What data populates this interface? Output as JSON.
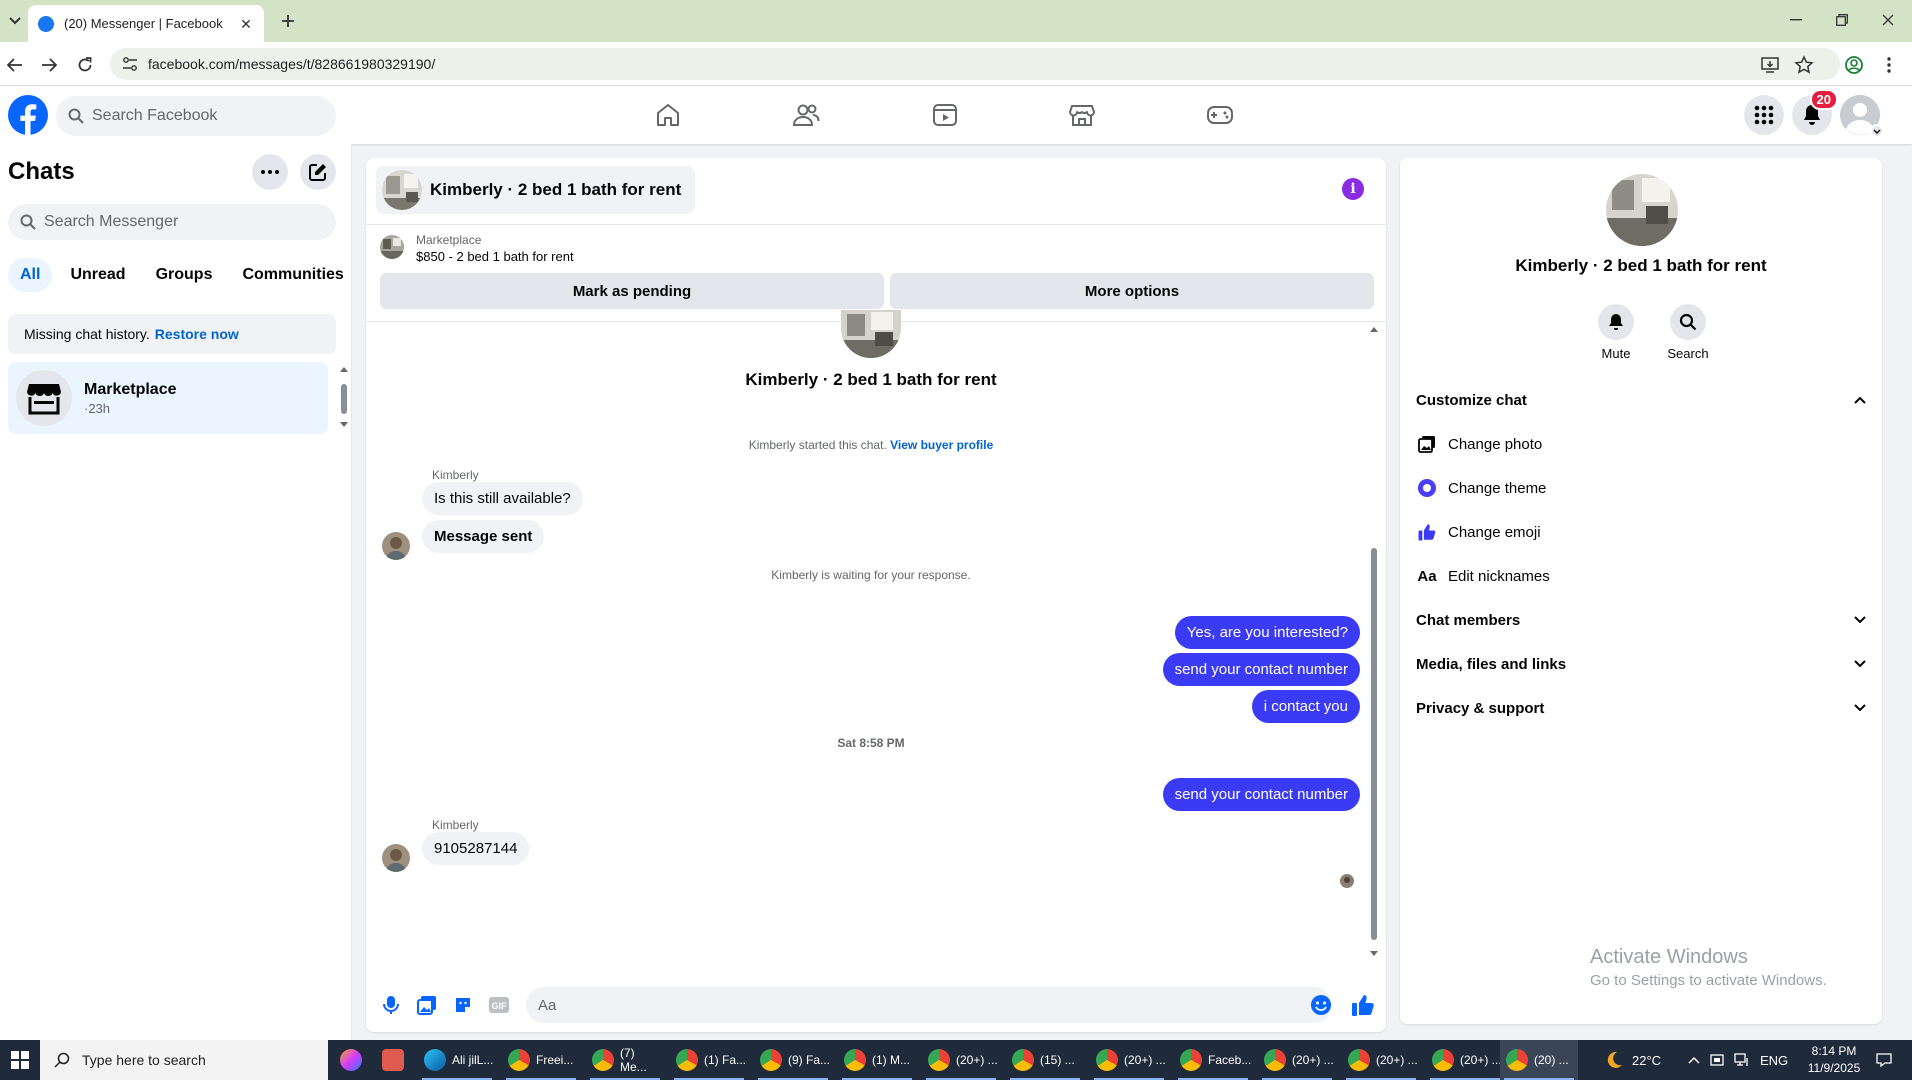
{
  "browser": {
    "tab_title": "(20) Messenger | Facebook",
    "url": "facebook.com/messages/t/828661980329190/"
  },
  "fb_header": {
    "search_placeholder": "Search Facebook",
    "notification_count": "20"
  },
  "sidebar": {
    "title": "Chats",
    "search_placeholder": "Search Messenger",
    "filters": [
      "All",
      "Unread",
      "Groups",
      "Communities"
    ],
    "history_notice": "Missing chat history.",
    "history_link": "Restore now",
    "chat_item": {
      "name": "Marketplace",
      "time": "·23h"
    }
  },
  "conversation": {
    "header_title": "Kimberly · 2 bed 1 bath for rent",
    "marketplace_label": "Marketplace",
    "listing": "$850 - 2 bed 1 bath for rent",
    "mark_pending": "Mark as pending",
    "more_options": "More options",
    "chat_title": "Kimberly · 2 bed 1 bath for rent",
    "started_text": "Kimberly started this chat.",
    "view_profile": "View buyer profile",
    "sender_name_1": "Kimberly",
    "msg_in_1": "Is this still available?",
    "msg_in_2": "Message sent",
    "waiting_text": "Kimberly is waiting for your response.",
    "msg_out_1": "Yes, are you interested?",
    "msg_out_2": "send your contact number",
    "msg_out_3": "i contact you",
    "timestamp": "Sat 8:58 PM",
    "msg_out_4": "send your contact number",
    "sender_name_2": "Kimberly",
    "msg_in_3": "9105287144",
    "composer_placeholder": "Aa"
  },
  "info_panel": {
    "name": "Kimberly · 2 bed 1 bath for rent",
    "mute_label": "Mute",
    "search_label": "Search",
    "customize_chat": "Customize chat",
    "change_photo": "Change photo",
    "change_theme": "Change theme",
    "change_emoji": "Change emoji",
    "edit_nicknames": "Edit nicknames",
    "chat_members": "Chat members",
    "media_files": "Media, files and links",
    "privacy_support": "Privacy & support",
    "nickname_icon_text": "Aa"
  },
  "watermark": {
    "line1": "Activate Windows",
    "line2": "Go to Settings to activate Windows."
  },
  "taskbar": {
    "search_placeholder": "Type here to search",
    "apps": [
      "Ali jilL...",
      "Freei...",
      "(7) Me...",
      "(1) Fa...",
      "(9) Fa...",
      "(1) M...",
      "(20+) ...",
      "(15) ...",
      "(20+) ...",
      "Faceb...",
      "(20+) ...",
      "(20+) ...",
      "(20+) ...",
      "(20) ..."
    ],
    "weather": "22°C",
    "language": "ENG",
    "time": "8:14 PM",
    "date": "11/9/2025"
  },
  "colors": {
    "accent": "#1877f2",
    "outgoing_bubble": "#3b3bf5",
    "link": "#0064d1",
    "info_button": "#8a2be2",
    "badge": "#e41e3f"
  }
}
